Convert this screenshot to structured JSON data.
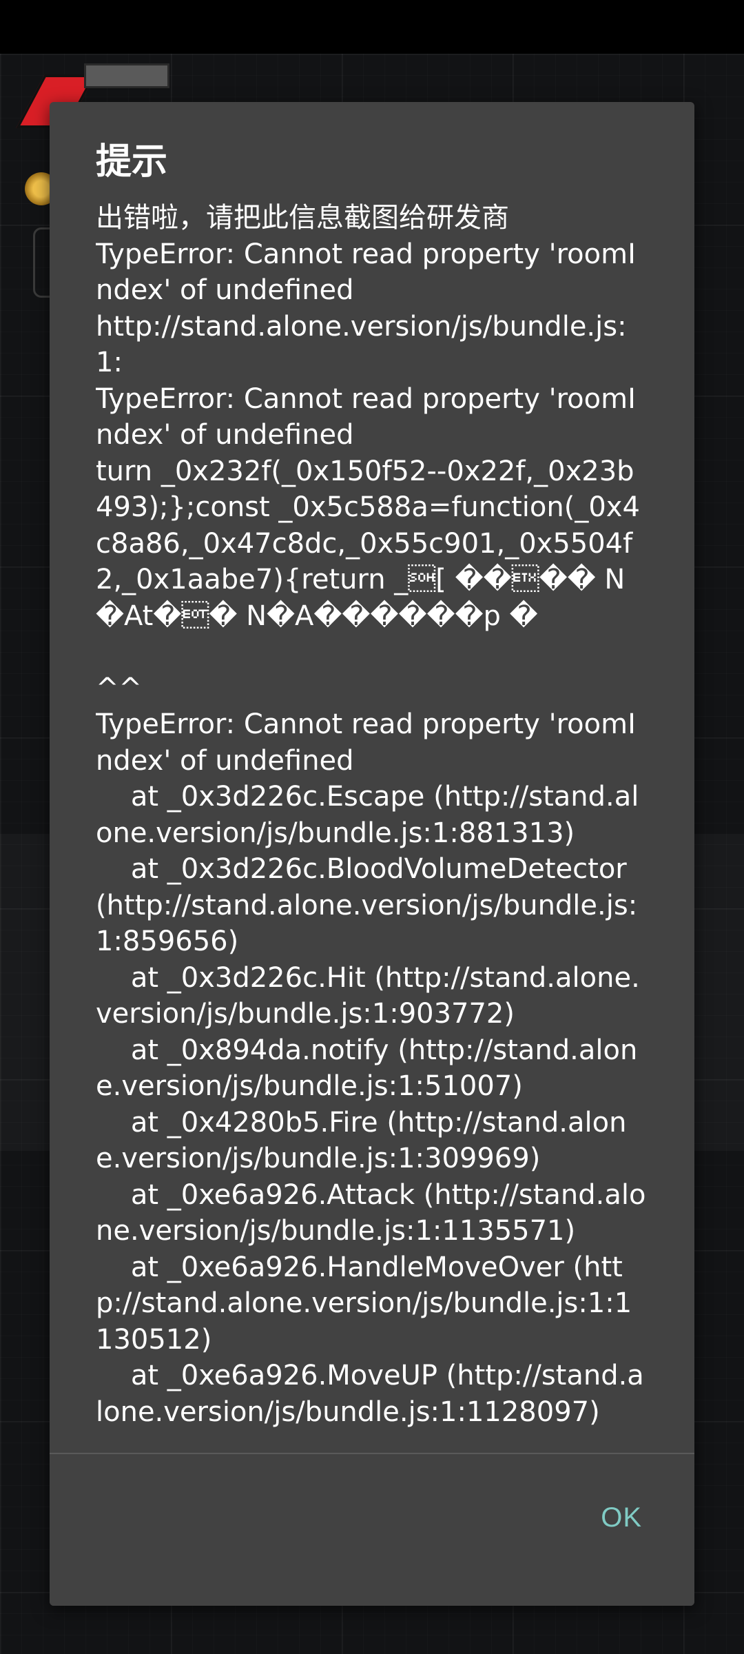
{
  "dialog": {
    "title": "提示",
    "message": "出错啦，请把此信息截图给研发商\nTypeError: Cannot read property 'roomIndex' of undefined\nhttp://stand.alone.version/js/bundle.js:1:\nTypeError: Cannot read property 'roomIndex' of undefined\nturn _0x232f(_0x150f52--0x22f,_0x23b493);};const _0x5c588a=function(_0x4c8a86,_0x47c8dc,_0x55c901,_0x5504f2,_0x1aabe7){return _\u0001[ ��\u0003�� N�At�\u0004� N�A������p �\n\n^^\nTypeError: Cannot read property 'roomIndex' of undefined\n    at _0x3d226c.Escape (http://stand.alone.version/js/bundle.js:1:881313)\n    at _0x3d226c.BloodVolumeDetector (http://stand.alone.version/js/bundle.js:1:859656)\n    at _0x3d226c.Hit (http://stand.alone.version/js/bundle.js:1:903772)\n    at _0x894da.notify (http://stand.alone.version/js/bundle.js:1:51007)\n    at _0x4280b5.Fire (http://stand.alone.version/js/bundle.js:1:309969)\n    at _0xe6a926.Attack (http://stand.alone.version/js/bundle.js:1:1135571)\n    at _0xe6a926.HandleMoveOver (http://stand.alone.version/js/bundle.js:1:1130512)\n    at _0xe6a926.MoveUP (http://stand.alone.version/js/bundle.js:1:1128097)",
    "ok_label": "OK"
  },
  "colors": {
    "dialog_background": "#424242",
    "accent": "#80cbc4",
    "text": "#ffffff"
  }
}
